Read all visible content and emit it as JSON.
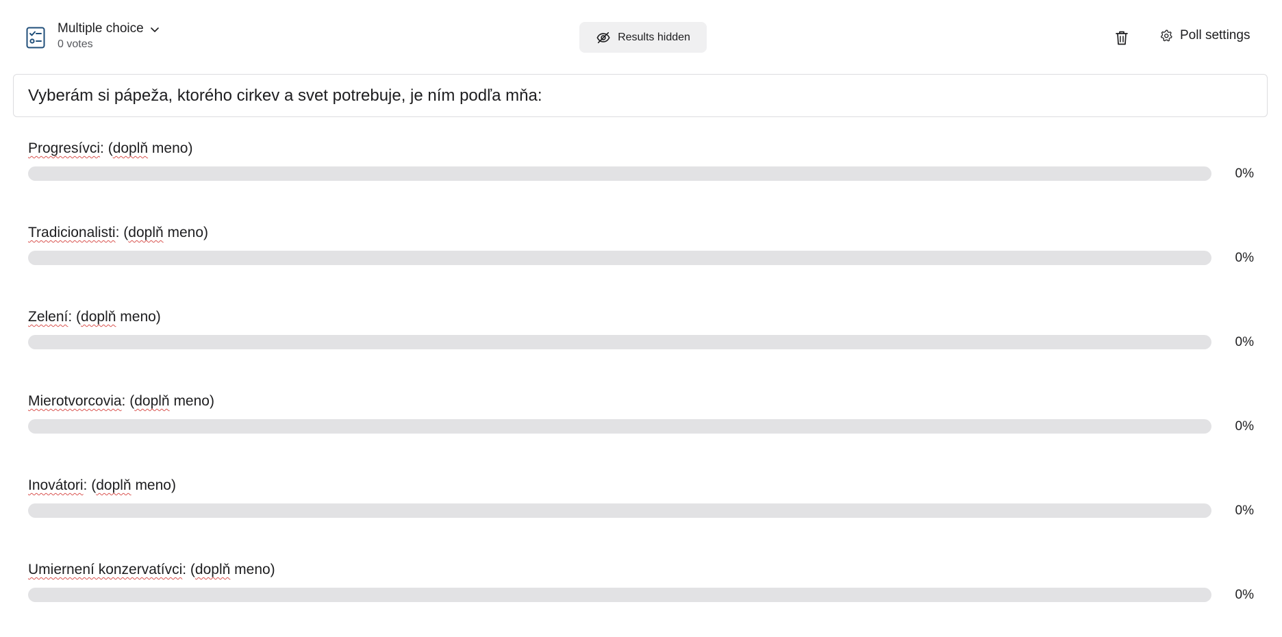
{
  "header": {
    "poll_type": "Multiple choice",
    "votes": "0 votes",
    "results_button": "Results hidden",
    "settings_button": "Poll settings",
    "type_icon": "checklist-icon",
    "chevron_icon": "chevron-down-icon",
    "eye_icon": "eye-off-icon",
    "trash_icon": "trash-icon",
    "gear_icon": "gear-icon"
  },
  "question": "Vyberám si pápeža, ktorého cirkev a svet potrebuje, je ním podľa mňa:",
  "options": [
    {
      "prefix": "Progresívci",
      "mid": ": (",
      "word": "doplň",
      "suffix": " meno)",
      "percent": "0%",
      "fraction": 0
    },
    {
      "prefix": "Tradicionalisti",
      "mid": ": (",
      "word": "doplň",
      "suffix": " meno)",
      "percent": "0%",
      "fraction": 0
    },
    {
      "prefix": "Zelení",
      "mid": ": (",
      "word": "doplň",
      "suffix": " meno)",
      "percent": "0%",
      "fraction": 0
    },
    {
      "prefix": "Mierotvorcovia",
      "mid": ": (",
      "word": "doplň",
      "suffix": " meno)",
      "percent": "0%",
      "fraction": 0
    },
    {
      "prefix": "Inovátori",
      "mid": ": (",
      "word": "doplň",
      "suffix": " meno)",
      "percent": "0%",
      "fraction": 0
    },
    {
      "prefix": "Umiernení konzervatívci",
      "mid": ": (",
      "word": "doplň",
      "suffix": " meno)",
      "percent": "0%",
      "fraction": 0
    }
  ],
  "colors": {
    "track": "#e2e2e4",
    "fill": "#6f6f74",
    "accent_icon": "#1f4e79",
    "spellcheck": "#d9534f"
  }
}
